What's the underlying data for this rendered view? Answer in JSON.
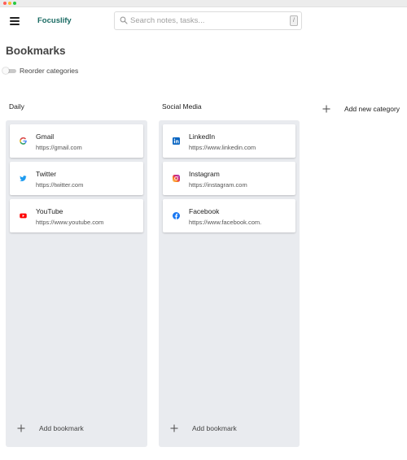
{
  "app": {
    "brand": "Focuslify"
  },
  "search": {
    "placeholder": "Search notes, tasks...",
    "value": "",
    "shortcut": "/"
  },
  "page": {
    "title": "Bookmarks",
    "reorder_label": "Reorder categories",
    "reorder_enabled": false,
    "add_category_label": "Add new category"
  },
  "categories": [
    {
      "title": "Daily",
      "add_bookmark_label": "Add bookmark",
      "bookmarks": [
        {
          "name": "Gmail",
          "url": "https://gmail.com",
          "icon": "google-icon"
        },
        {
          "name": "Twitter",
          "url": "https://twitter.com",
          "icon": "twitter-icon"
        },
        {
          "name": "YouTube",
          "url": "https://www.youtube.com",
          "icon": "youtube-icon"
        }
      ]
    },
    {
      "title": "Social Media",
      "add_bookmark_label": "Add bookmark",
      "bookmarks": [
        {
          "name": "LinkedIn",
          "url": "https://www.linkedin.com",
          "icon": "linkedin-icon"
        },
        {
          "name": "Instagram",
          "url": "https://instagram.com",
          "icon": "instagram-icon"
        },
        {
          "name": "Facebook",
          "url": "https://www.facebook.com.",
          "icon": "facebook-icon"
        }
      ]
    }
  ],
  "colors": {
    "brand": "#1a6b63",
    "column_bg": "#e9ebef",
    "twitter": "#1d9bf0",
    "youtube": "#ff0000",
    "linkedin": "#0a66c2",
    "facebook": "#1877f2"
  }
}
